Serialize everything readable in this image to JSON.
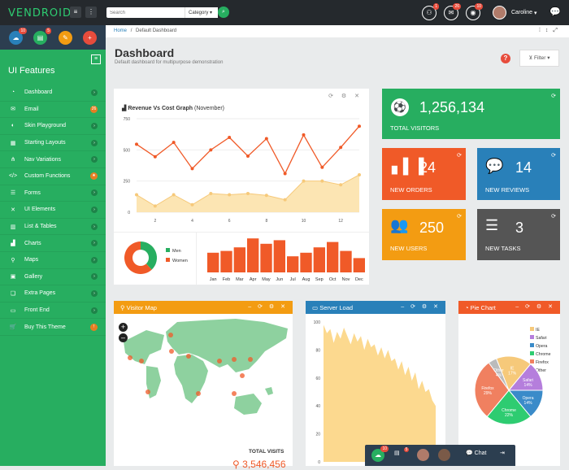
{
  "app": {
    "logo": "VENDROID",
    "search_placeholder": "Search",
    "category": "Category",
    "user_name": "Caroline"
  },
  "top_badges": {
    "users": "1",
    "mail": "26",
    "globe": "10"
  },
  "sidebar_quick": {
    "cloud_badge": "10",
    "list_badge": "5"
  },
  "sidebar": {
    "title": "UI Features",
    "items": [
      {
        "label": "Dashboard",
        "icon": "gauge-icon"
      },
      {
        "label": "Email",
        "icon": "email-icon",
        "badge": "26"
      },
      {
        "label": "Skin Playground",
        "icon": "palette-icon"
      },
      {
        "label": "Starting Layouts",
        "icon": "layout-icon"
      },
      {
        "label": "Nav Variations",
        "icon": "nav-icon"
      },
      {
        "label": "Custom Functions",
        "icon": "code-icon",
        "badge": "★"
      },
      {
        "label": "Forms",
        "icon": "forms-icon"
      },
      {
        "label": "UI Elements",
        "icon": "tools-icon"
      },
      {
        "label": "List & Tables",
        "icon": "table-icon"
      },
      {
        "label": "Charts",
        "icon": "chart-icon"
      },
      {
        "label": "Maps",
        "icon": "map-pin-icon"
      },
      {
        "label": "Gallery",
        "icon": "gallery-icon"
      },
      {
        "label": "Extra Pages",
        "icon": "pages-icon"
      },
      {
        "label": "Front End",
        "icon": "monitor-icon"
      },
      {
        "label": "Buy This Theme",
        "icon": "cart-icon",
        "badge": "!"
      }
    ]
  },
  "breadcrumb": {
    "home": "Home",
    "current": "Default Dashboard"
  },
  "page": {
    "title": "Dashboard",
    "subtitle": "Default dashboard for multipurpose demonstration",
    "filter": "Filter"
  },
  "revenue": {
    "title_bold": "Revenue Vs Cost Graph",
    "title_rest": "(November)"
  },
  "stats": {
    "visitors": {
      "value": "1,256,134",
      "label": "TOTAL VISITORS",
      "color": "#27ae60"
    },
    "orders": {
      "value": "24",
      "label": "NEW ORDERS",
      "color": "#f05a28"
    },
    "reviews": {
      "value": "14",
      "label": "NEW REVIEWS",
      "color": "#2980b9"
    },
    "users": {
      "value": "250",
      "label": "NEW USERS",
      "color": "#f39c12"
    },
    "tasks": {
      "value": "3",
      "label": "NEW TASKS",
      "color": "#555555"
    }
  },
  "visitor_map": {
    "title": "Visitor Map",
    "total_label": "TOTAL VISITS",
    "total_value": "3,546,456"
  },
  "server_load": {
    "title": "Server Load"
  },
  "pie": {
    "title": "Pie Chart"
  },
  "chat": {
    "cloud_badge": "10",
    "list_badge": "5",
    "chat_label": "Chat"
  },
  "chart_data": [
    {
      "type": "line",
      "title": "Revenue Vs Cost Graph (November)",
      "x": [
        1,
        2,
        3,
        4,
        5,
        6,
        7,
        8,
        9,
        10,
        11,
        12,
        13
      ],
      "x_ticks": [
        2,
        4,
        6,
        8,
        10,
        12
      ],
      "ylim": [
        0,
        750
      ],
      "y_ticks": [
        0,
        250,
        500,
        750
      ],
      "series": [
        {
          "values": [
            545,
            445,
            560,
            350,
            500,
            600,
            450,
            590,
            310,
            620,
            360,
            520,
            690
          ],
          "color": "#f05a28"
        },
        {
          "values": [
            140,
            50,
            140,
            60,
            150,
            140,
            150,
            135,
            100,
            250,
            250,
            220,
            300
          ],
          "color": "#f6c97a",
          "fill": "#fce5b3"
        }
      ]
    },
    {
      "type": "pie",
      "legend": [
        "Men",
        "Women"
      ],
      "values": [
        38,
        62
      ],
      "colors": [
        "#27ae60",
        "#f05a28"
      ]
    },
    {
      "type": "bar",
      "categories": [
        "Jan",
        "Feb",
        "Mar",
        "Apr",
        "May",
        "Jun",
        "Jul",
        "Aug",
        "Sep",
        "Oct",
        "Nov",
        "Dec"
      ],
      "values": [
        55,
        60,
        70,
        95,
        80,
        90,
        45,
        55,
        70,
        85,
        60,
        40
      ],
      "ylim": [
        0,
        100
      ],
      "color": "#f05a28"
    },
    {
      "type": "area",
      "values": [
        98,
        92,
        95,
        85,
        93,
        88,
        96,
        90,
        84,
        92,
        86,
        90,
        80,
        88,
        82,
        84,
        76,
        82,
        74,
        80,
        72,
        74,
        66,
        72,
        62,
        68,
        58,
        64,
        52,
        58,
        50,
        52,
        44,
        40
      ],
      "ylim": [
        0,
        100
      ],
      "color": "#fcd98f"
    },
    {
      "type": "pie",
      "legend": [
        "IE",
        "Safari",
        "Opera",
        "Chrome",
        "Firefox",
        "Other"
      ],
      "values": [
        17,
        14,
        14,
        22,
        29,
        4
      ],
      "labels": [
        "IE\n17%",
        "Safari\n14%",
        "Opera\n14%",
        "Chrome\n22%",
        "Firefox\n29%",
        "Other\n4%"
      ],
      "colors": [
        "#f6c97a",
        "#b57edc",
        "#3a8bc9",
        "#2ecc71",
        "#f08060",
        "#bbbbbb"
      ]
    }
  ]
}
